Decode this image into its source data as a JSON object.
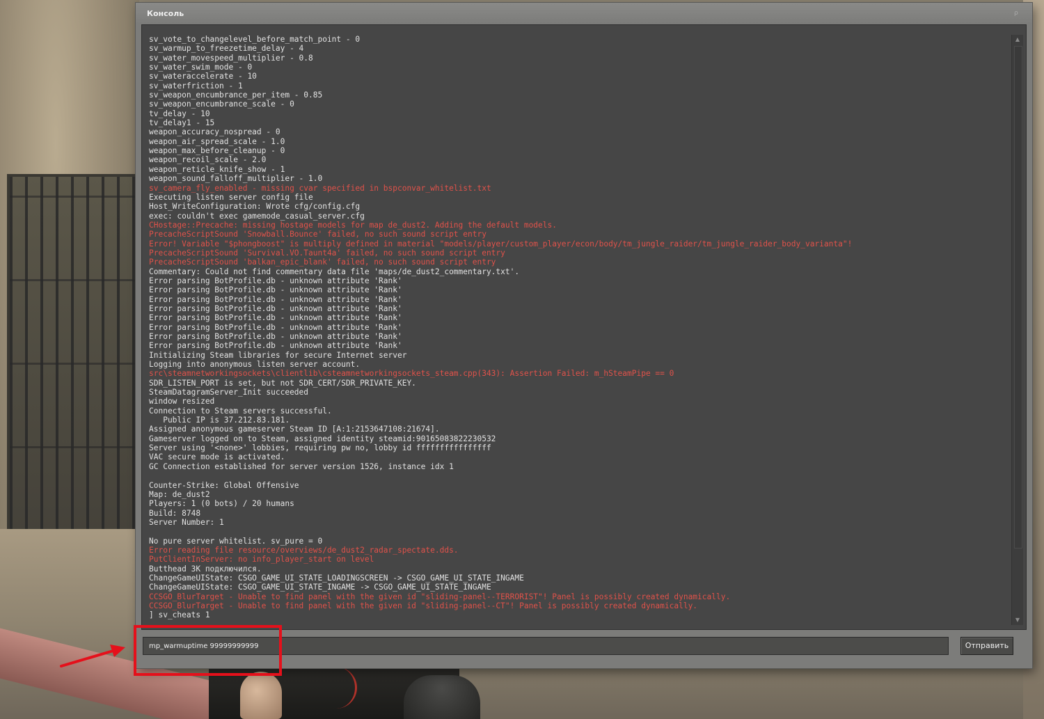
{
  "window": {
    "title": "Консоль",
    "accent_color": "#e1524a"
  },
  "output": {
    "lines": [
      {
        "text": "sv_vote_to_changelevel_before_match_point - 0",
        "error": false
      },
      {
        "text": "sv_warmup_to_freezetime_delay - 4",
        "error": false
      },
      {
        "text": "sv_water_movespeed_multiplier - 0.8",
        "error": false
      },
      {
        "text": "sv_water_swim_mode - 0",
        "error": false
      },
      {
        "text": "sv_wateraccelerate - 10",
        "error": false
      },
      {
        "text": "sv_waterfriction - 1",
        "error": false
      },
      {
        "text": "sv_weapon_encumbrance_per_item - 0.85",
        "error": false
      },
      {
        "text": "sv_weapon_encumbrance_scale - 0",
        "error": false
      },
      {
        "text": "tv_delay - 10",
        "error": false
      },
      {
        "text": "tv_delay1 - 15",
        "error": false
      },
      {
        "text": "weapon_accuracy_nospread - 0",
        "error": false
      },
      {
        "text": "weapon_air_spread_scale - 1.0",
        "error": false
      },
      {
        "text": "weapon_max_before_cleanup - 0",
        "error": false
      },
      {
        "text": "weapon_recoil_scale - 2.0",
        "error": false
      },
      {
        "text": "weapon_reticle_knife_show - 1",
        "error": false
      },
      {
        "text": "weapon_sound_falloff_multiplier - 1.0",
        "error": false
      },
      {
        "text": "sv_camera_fly_enabled - missing cvar specified in bspconvar_whitelist.txt",
        "error": true
      },
      {
        "text": "Executing listen server config file",
        "error": false
      },
      {
        "text": "Host_WriteConfiguration: Wrote cfg/config.cfg",
        "error": false
      },
      {
        "text": "exec: couldn't exec gamemode_casual_server.cfg",
        "error": false
      },
      {
        "text": "CHostage::Precache: missing hostage models for map de_dust2. Adding the default models.",
        "error": true
      },
      {
        "text": "PrecacheScriptSound 'Snowball.Bounce' failed, no such sound script entry",
        "error": true
      },
      {
        "text": "Error! Variable \"$phongboost\" is multiply defined in material \"models/player/custom_player/econ/body/tm_jungle_raider/tm_jungle_raider_body_varianta\"!",
        "error": true
      },
      {
        "text": "PrecacheScriptSound 'Survival.VO.Taunt4a' failed, no such sound script entry",
        "error": true
      },
      {
        "text": "PrecacheScriptSound 'balkan_epic_blank' failed, no such sound script entry",
        "error": true
      },
      {
        "text": "Commentary: Could not find commentary data file 'maps/de_dust2_commentary.txt'.",
        "error": false
      },
      {
        "text": "Error parsing BotProfile.db - unknown attribute 'Rank'",
        "error": false
      },
      {
        "text": "Error parsing BotProfile.db - unknown attribute 'Rank'",
        "error": false
      },
      {
        "text": "Error parsing BotProfile.db - unknown attribute 'Rank'",
        "error": false
      },
      {
        "text": "Error parsing BotProfile.db - unknown attribute 'Rank'",
        "error": false
      },
      {
        "text": "Error parsing BotProfile.db - unknown attribute 'Rank'",
        "error": false
      },
      {
        "text": "Error parsing BotProfile.db - unknown attribute 'Rank'",
        "error": false
      },
      {
        "text": "Error parsing BotProfile.db - unknown attribute 'Rank'",
        "error": false
      },
      {
        "text": "Error parsing BotProfile.db - unknown attribute 'Rank'",
        "error": false
      },
      {
        "text": "Initializing Steam libraries for secure Internet server",
        "error": false
      },
      {
        "text": "Logging into anonymous listen server account.",
        "error": false
      },
      {
        "text": "src\\steamnetworkingsockets\\clientlib\\csteamnetworkingsockets_steam.cpp(343): Assertion Failed: m_hSteamPipe == 0",
        "error": true
      },
      {
        "text": "SDR_LISTEN_PORT is set, but not SDR_CERT/SDR_PRIVATE_KEY.",
        "error": false
      },
      {
        "text": "SteamDatagramServer_Init succeeded",
        "error": false
      },
      {
        "text": "window resized",
        "error": false
      },
      {
        "text": "Connection to Steam servers successful.",
        "error": false
      },
      {
        "text": "   Public IP is 37.212.83.181.",
        "error": false
      },
      {
        "text": "Assigned anonymous gameserver Steam ID [A:1:2153647108:21674].",
        "error": false
      },
      {
        "text": "Gameserver logged on to Steam, assigned identity steamid:90165083822230532",
        "error": false
      },
      {
        "text": "Server using '<none>' lobbies, requiring pw no, lobby id ffffffffffffffff",
        "error": false
      },
      {
        "text": "VAC secure mode is activated.",
        "error": false
      },
      {
        "text": "GC Connection established for server version 1526, instance idx 1",
        "error": false
      },
      {
        "text": "",
        "error": false
      },
      {
        "text": "Counter-Strike: Global Offensive",
        "error": false
      },
      {
        "text": "Map: de_dust2",
        "error": false
      },
      {
        "text": "Players: 1 (0 bots) / 20 humans",
        "error": false
      },
      {
        "text": "Build: 8748",
        "error": false
      },
      {
        "text": "Server Number: 1",
        "error": false
      },
      {
        "text": "",
        "error": false
      },
      {
        "text": "No pure server whitelist. sv_pure = 0",
        "error": false
      },
      {
        "text": "Error reading file resource/overviews/de_dust2_radar_spectate.dds.",
        "error": true
      },
      {
        "text": "PutClientInServer: no info_player_start on level",
        "error": true
      },
      {
        "text": "Butthead 3K подключился.",
        "error": false
      },
      {
        "text": "ChangeGameUIState: CSGO_GAME_UI_STATE_LOADINGSCREEN -> CSGO_GAME_UI_STATE_INGAME",
        "error": false
      },
      {
        "text": "ChangeGameUIState: CSGO_GAME_UI_STATE_INGAME -> CSGO_GAME_UI_STATE_INGAME",
        "error": false
      },
      {
        "text": "CCSGO_BlurTarget - Unable to find panel with the given id \"sliding-panel--TERRORIST\"! Panel is possibly created dynamically.",
        "error": true
      },
      {
        "text": "CCSGO_BlurTarget - Unable to find panel with the given id \"sliding-panel--CT\"! Panel is possibly created dynamically.",
        "error": true
      },
      {
        "text": "] sv_cheats 1",
        "error": false
      }
    ]
  },
  "input": {
    "value": "mp_warmuptime 99999999999"
  },
  "submit": {
    "label": "Отправить"
  },
  "annotation": {
    "color": "#e5101b"
  }
}
